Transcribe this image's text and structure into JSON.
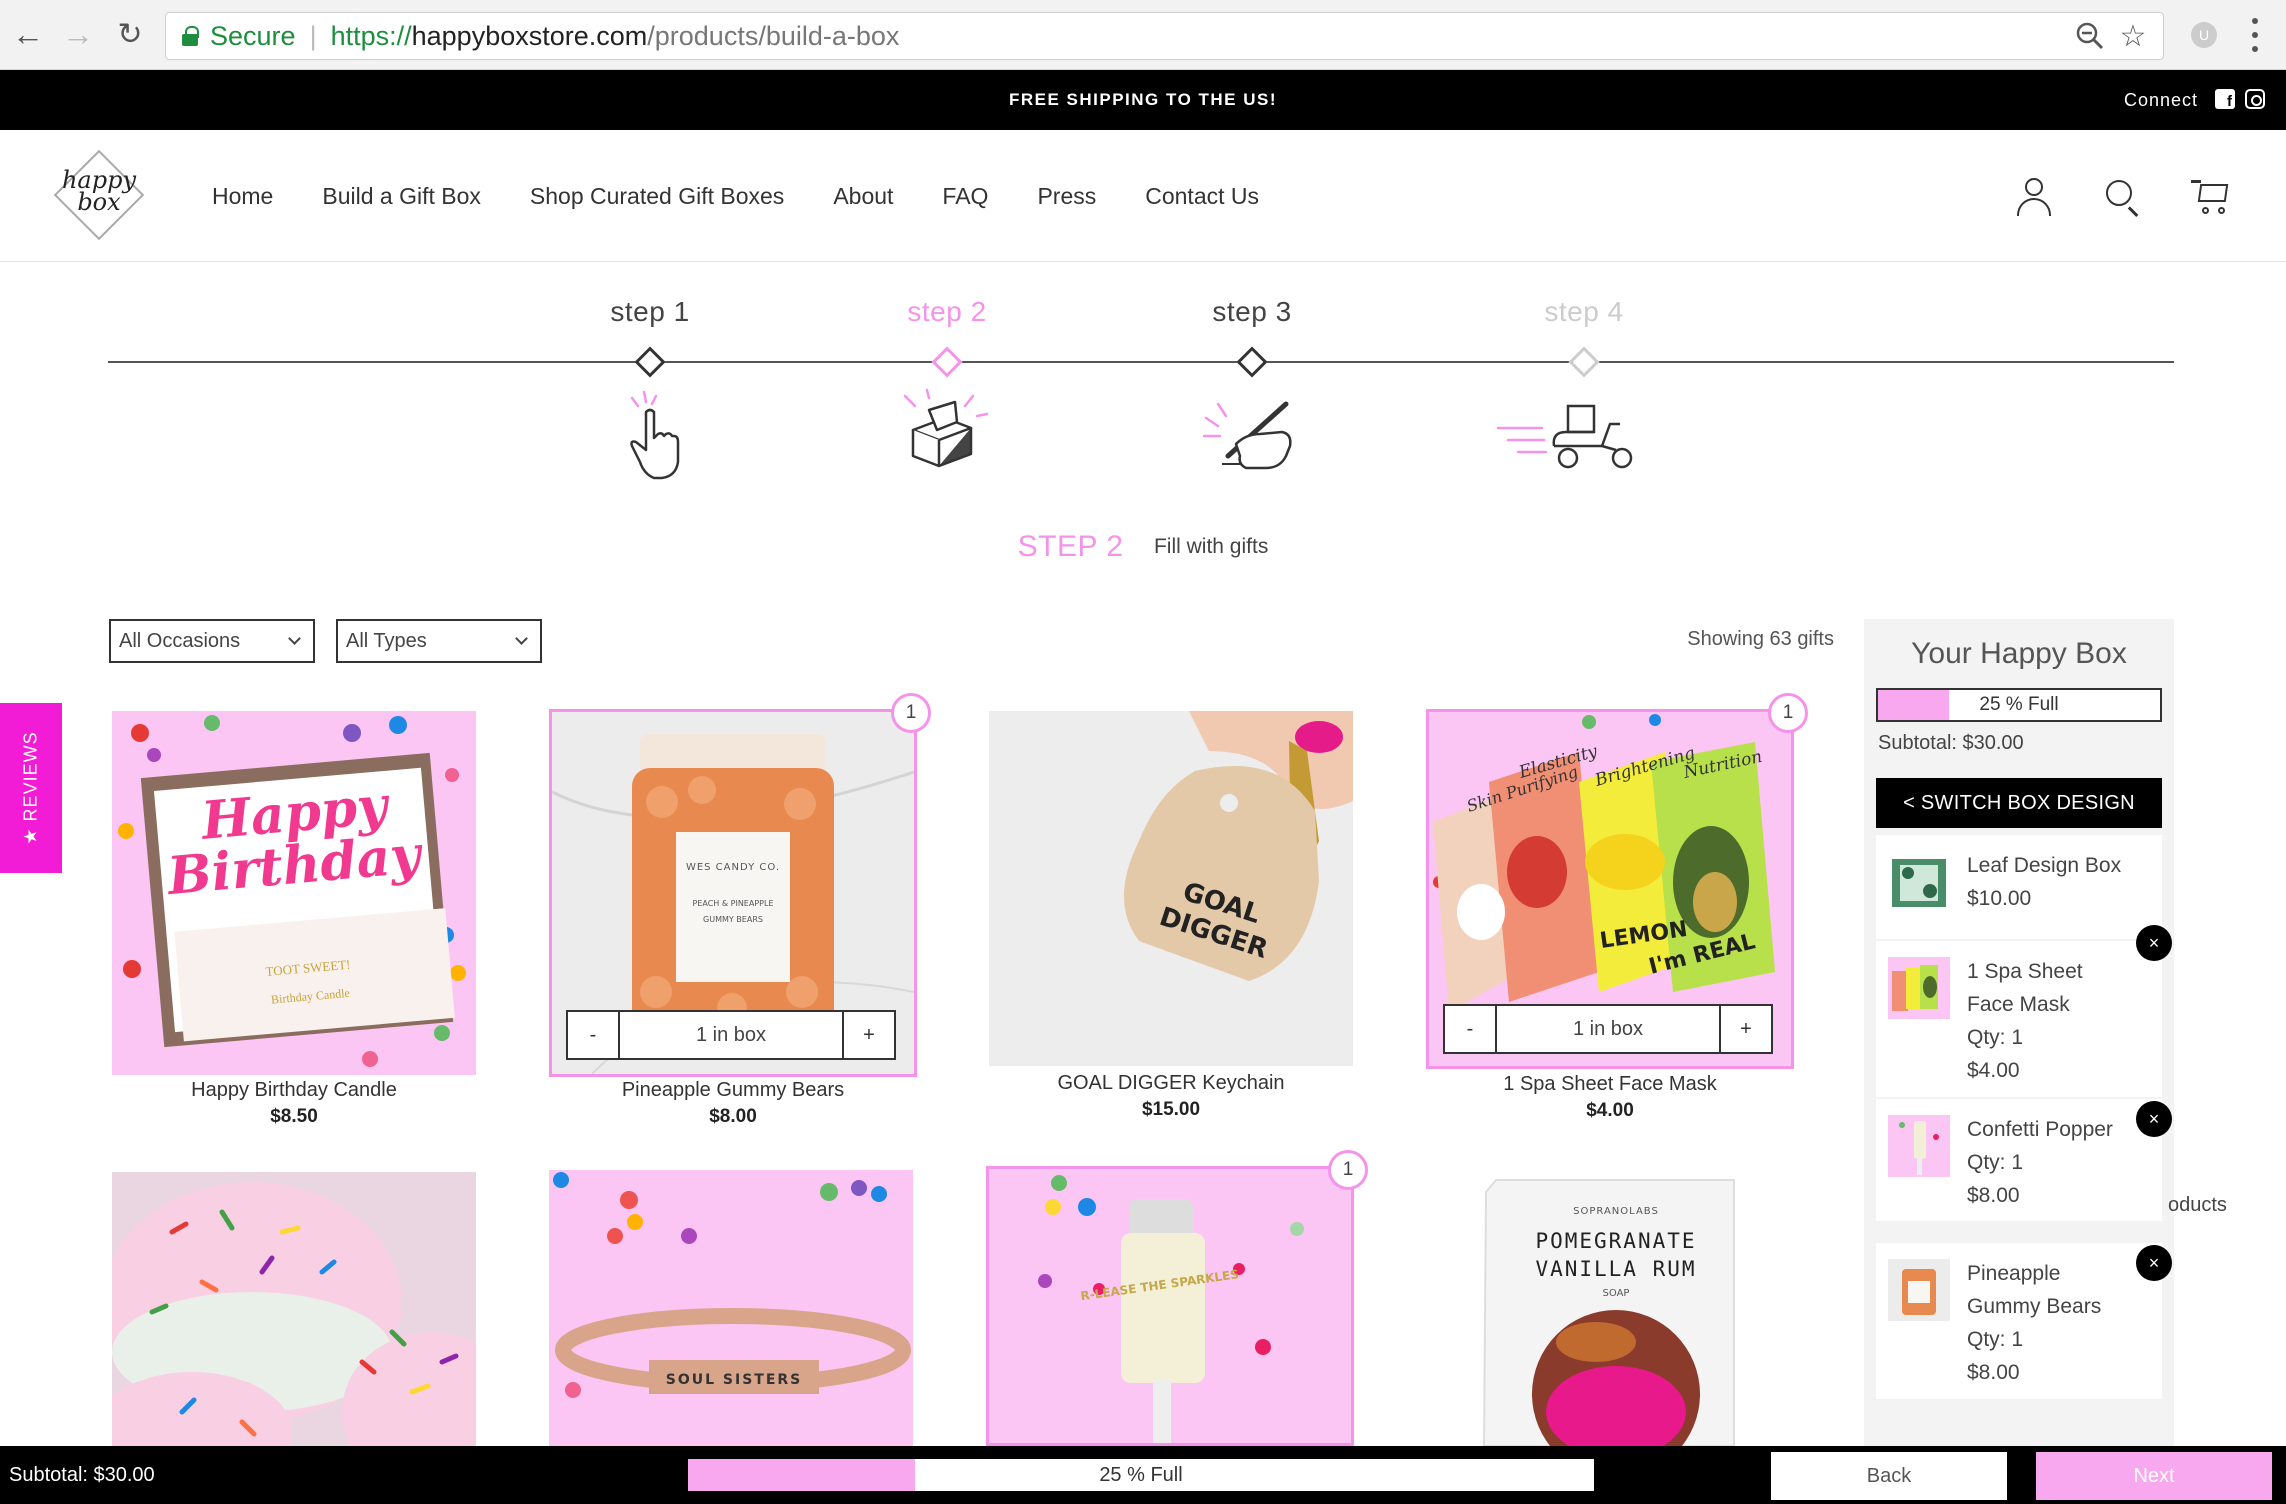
{
  "browser": {
    "secure_label": "Secure",
    "url_scheme": "https://",
    "url_host": "happyboxstore.com",
    "url_path": "/products/build-a-box"
  },
  "announcement": {
    "shipping": "FREE SHIPPING TO THE US!",
    "connect": "Connect"
  },
  "logo": {
    "line1": "happy",
    "line2": "box"
  },
  "nav": {
    "items": [
      {
        "label": "Home"
      },
      {
        "label": "Build a Gift Box"
      },
      {
        "label": "Shop Curated Gift Boxes"
      },
      {
        "label": "About"
      },
      {
        "label": "FAQ"
      },
      {
        "label": "Press"
      },
      {
        "label": "Contact Us"
      }
    ]
  },
  "steps": [
    {
      "label": "step 1",
      "state": "done",
      "icon": "pointing-hand-icon"
    },
    {
      "label": "step 2",
      "state": "active",
      "icon": "open-box-icon"
    },
    {
      "label": "step 3",
      "state": "done",
      "icon": "writing-hand-icon"
    },
    {
      "label": "step 4",
      "state": "future",
      "icon": "delivery-scooter-icon"
    }
  ],
  "step_heading": {
    "number": "STEP 2",
    "description": "Fill with gifts"
  },
  "filters": {
    "occasion": "All Occasions",
    "type": "All Types",
    "showing": "Showing 63 gifts"
  },
  "products": [
    {
      "name": "Happy Birthday Candle",
      "price": "$8.50",
      "selected": false,
      "qty": ""
    },
    {
      "name": "Pineapple Gummy Bears",
      "price": "$8.00",
      "selected": true,
      "qty": "1",
      "in_box": "1 in box"
    },
    {
      "name": "GOAL DIGGER Keychain",
      "price": "$15.00",
      "selected": false,
      "qty": ""
    },
    {
      "name": "1 Spa Sheet Face Mask",
      "price": "$4.00",
      "selected": true,
      "qty": "1",
      "in_box": "1 in box"
    },
    {
      "name": "",
      "price": "",
      "selected": false,
      "qty": ""
    },
    {
      "name": "",
      "price": "",
      "selected": false,
      "qty": ""
    },
    {
      "name": "",
      "price": "",
      "selected": true,
      "qty": "1"
    },
    {
      "name": "",
      "price": "",
      "selected": false,
      "qty": ""
    }
  ],
  "product_art": {
    "candle_text1": "Happy",
    "candle_text2": "Birthday",
    "candle_card": "TOOT SWEET!",
    "candle_card_sub": "Birthday Candle",
    "gummy_label1": "WES CANDY CO.",
    "gummy_label2": "PEACH & PINEAPPLE",
    "gummy_label3": "GUMMY BEARS",
    "keychain_text1": "GOAL",
    "keychain_text2": "DIGGER",
    "mask1": "Skin Purifying",
    "mask2": "Elasticity",
    "mask3": "Brightening",
    "mask4": "Nutrition",
    "mask_brand": "I'm REAL",
    "mask_lemon": "LEMON",
    "bracelet_text": "SOUL SISTERS",
    "popper_text": "R-LEASE THE SPARKLES",
    "soap_brand": "SOPRANOLABS",
    "soap_line1": "POMEGRANATE",
    "soap_line2": "VANILLA RUM",
    "soap_line3": "SOAP"
  },
  "reviews_tab": "★ REVIEWS",
  "sidebar": {
    "title": "Your Happy Box",
    "progress_percent": 25,
    "progress_label": "25 % Full",
    "subtotal": "Subtotal: $30.00",
    "switch_label": "< SWITCH BOX DESIGN",
    "box": {
      "name": "Leaf Design Box",
      "price": "$10.00"
    },
    "items": [
      {
        "name_line1": "1 Spa Sheet",
        "name_line2": "Face Mask",
        "qty": "Qty: 1",
        "price": "$4.00"
      },
      {
        "name_line1": "Confetti Popper",
        "qty": "Qty: 1",
        "price": "$8.00"
      },
      {
        "name_line1": "Pineapple",
        "name_line2": "Gummy Bears",
        "qty": "Qty: 1",
        "price": "$8.00"
      }
    ]
  },
  "stray_text": "oducts",
  "bottom_bar": {
    "subtotal": "Subtotal: $30.00",
    "progress_percent": 25,
    "progress_label": "25 % Full",
    "back": "Back",
    "next": "Next"
  },
  "colors": {
    "accent_pink": "#f593eb",
    "progress_pink": "#f7a8ee",
    "reviews_magenta": "#f21bd6",
    "secure_green": "#1e8e3e"
  }
}
